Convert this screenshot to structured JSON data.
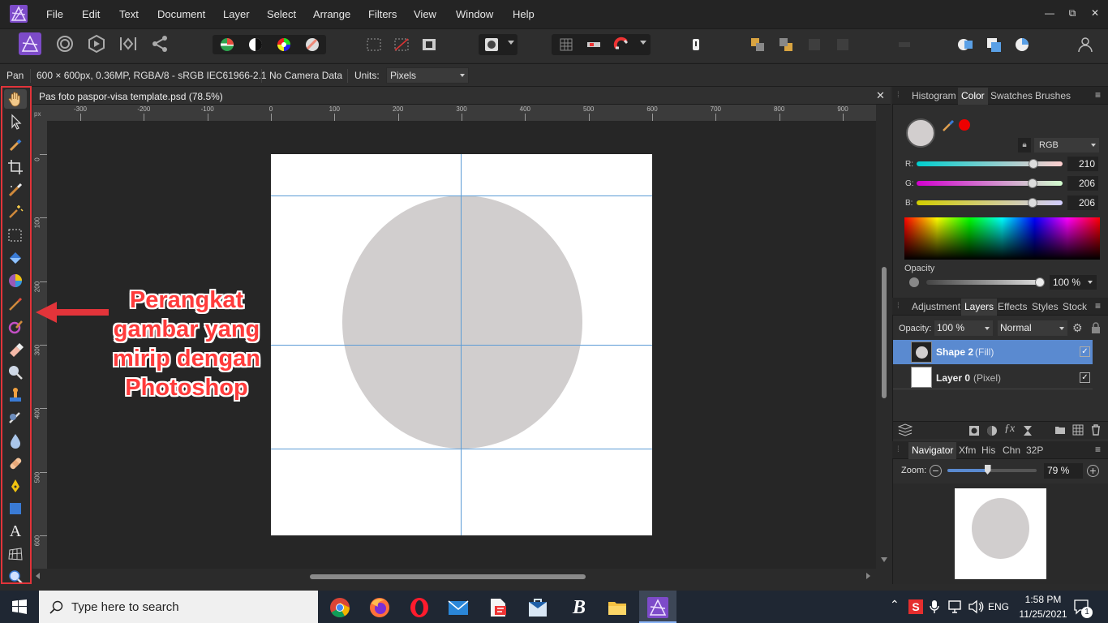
{
  "menubar": {
    "items": [
      "File",
      "Edit",
      "Text",
      "Document",
      "Layer",
      "Select",
      "Arrange",
      "Filters",
      "View",
      "Window",
      "Help"
    ],
    "window_controls": [
      "—",
      "⧉",
      "✕"
    ]
  },
  "context": {
    "tool": "Pan",
    "doc_info": "600 × 600px, 0.36MP, RGBA/8 - sRGB IEC61966-2.1",
    "camera": "No Camera Data",
    "units_label": "Units:",
    "units_value": "Pixels"
  },
  "document": {
    "tab_title": "Pas foto paspor-visa template.psd (78.5%)",
    "ruler_unit": "px",
    "h_ticks": [
      "-300",
      "-200",
      "-100",
      "0",
      "100",
      "200",
      "300",
      "400",
      "500",
      "600",
      "700",
      "800",
      "900"
    ],
    "v_ticks": [
      "0",
      "100",
      "200",
      "300",
      "400",
      "500",
      "600"
    ]
  },
  "annotation": {
    "lines": [
      "Perangkat",
      "gambar yang",
      "mirip dengan",
      "Photoshop"
    ],
    "color": "#e2343a"
  },
  "color_panel": {
    "tabs": [
      "Histogram",
      "Color",
      "Swatches",
      "Brushes"
    ],
    "active_tab": "Color",
    "model": "RGB",
    "r_label": "R:",
    "r_value": "210",
    "g_label": "G:",
    "g_value": "206",
    "b_label": "B:",
    "b_value": "206",
    "opacity_label": "Opacity",
    "opacity_value": "100 %",
    "swatch_color": "#d2cece"
  },
  "layers_panel": {
    "tabs": [
      "Adjustment",
      "Layers",
      "Effects",
      "Styles",
      "Stock"
    ],
    "active_tab": "Layers",
    "opacity_label": "Opacity:",
    "opacity_value": "100 %",
    "blend_mode": "Normal",
    "layers": [
      {
        "name": "Shape 2",
        "type": "(Fill)",
        "selected": true,
        "visible": true
      },
      {
        "name": "Layer 0",
        "type": "(Pixel)",
        "selected": false,
        "visible": true
      }
    ]
  },
  "navigator_panel": {
    "tabs": [
      "Navigator",
      "Xfm",
      "His",
      "Chn",
      "32P"
    ],
    "active_tab": "Navigator",
    "zoom_label": "Zoom:",
    "zoom_value": "79 %",
    "zoom_fraction": 0.79
  },
  "taskbar": {
    "search_placeholder": "Type here to search",
    "language": "ENG",
    "time": "1:58 PM",
    "date": "11/25/2021",
    "notification_count": "1"
  },
  "colors": {
    "accent": "#4b8bd6",
    "selected_layer": "#5a8ad0",
    "annotation": "#e2343a",
    "circle_fill": "#d1cece"
  }
}
